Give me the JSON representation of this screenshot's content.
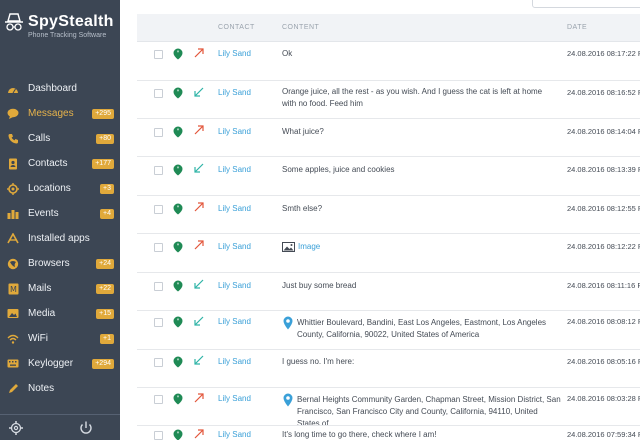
{
  "brand": {
    "title": "SpyStealth",
    "subtitle": "Phone Tracking Software"
  },
  "nav": [
    {
      "label": "Dashboard",
      "badge": "",
      "icon": "dashboard-icon",
      "active": false
    },
    {
      "label": "Messages",
      "badge": "+295",
      "icon": "messages-icon",
      "active": true
    },
    {
      "label": "Calls",
      "badge": "+80",
      "icon": "phone-icon",
      "active": false
    },
    {
      "label": "Contacts",
      "badge": "+177",
      "icon": "contacts-icon",
      "active": false
    },
    {
      "label": "Locations",
      "badge": "+3",
      "icon": "location-icon",
      "active": false
    },
    {
      "label": "Events",
      "badge": "+4",
      "icon": "events-icon",
      "active": false
    },
    {
      "label": "Installed apps",
      "badge": "",
      "icon": "apps-icon",
      "active": false
    },
    {
      "label": "Browsers",
      "badge": "+24",
      "icon": "browser-icon",
      "active": false
    },
    {
      "label": "Mails",
      "badge": "+22",
      "icon": "mail-icon",
      "active": false
    },
    {
      "label": "Media",
      "badge": "+15",
      "icon": "media-icon",
      "active": false
    },
    {
      "label": "WiFi",
      "badge": "+1",
      "icon": "wifi-icon",
      "active": false
    },
    {
      "label": "Keylogger",
      "badge": "+294",
      "icon": "keyboard-icon",
      "active": false
    },
    {
      "label": "Notes",
      "badge": "",
      "icon": "notes-icon",
      "active": false
    }
  ],
  "table": {
    "headers": {
      "contact": "CONTACT",
      "content": "CONTENT",
      "date": "DATE"
    },
    "rows": [
      {
        "direction": "outgoing",
        "contact": "Lily Sand",
        "content": "Ok",
        "kind": "text",
        "date": "24.08.2016 08:17:22 PM"
      },
      {
        "direction": "incoming",
        "contact": "Lily Sand",
        "content": "Orange juice, all the rest - as you wish. And I guess the cat is left at home with no food. Feed him",
        "kind": "text",
        "date": "24.08.2016 08:16:52 PM"
      },
      {
        "direction": "outgoing",
        "contact": "Lily Sand",
        "content": "What juice?",
        "kind": "text",
        "date": "24.08.2016 08:14:04 PM"
      },
      {
        "direction": "incoming",
        "contact": "Lily Sand",
        "content": "Some apples, juice and cookies",
        "kind": "text",
        "date": "24.08.2016 08:13:39 PM"
      },
      {
        "direction": "outgoing",
        "contact": "Lily Sand",
        "content": "Smth else?",
        "kind": "text",
        "date": "24.08.2016 08:12:55 PM"
      },
      {
        "direction": "outgoing",
        "contact": "Lily Sand",
        "content": "Image",
        "kind": "image",
        "date": "24.08.2016 08:12:22 PM"
      },
      {
        "direction": "incoming",
        "contact": "Lily Sand",
        "content": "Just buy some bread",
        "kind": "text",
        "date": "24.08.2016 08:11:16 PM"
      },
      {
        "direction": "incoming",
        "contact": "Lily Sand",
        "content": "Whittier Boulevard, Bandini, East Los Angeles, Eastmont, Los Angeles County, California, 90022, United States of America",
        "kind": "location",
        "date": "24.08.2016 08:08:12 PM"
      },
      {
        "direction": "incoming",
        "contact": "Lily Sand",
        "content": "I guess no. I'm here:",
        "kind": "text",
        "date": "24.08.2016 08:05:16 PM"
      },
      {
        "direction": "outgoing",
        "contact": "Lily Sand",
        "content": "Bernal Heights Community Garden, Chapman Street, Mission District, San Francisco, San Francisco City and County, California, 94110, United States of",
        "kind": "location",
        "date": "24.08.2016 08:03:28 PM"
      },
      {
        "direction": "outgoing",
        "contact": "Lily Sand",
        "content": "It's long time to go there, check where I am!",
        "kind": "text",
        "date": "24.08.2016 07:59:34 PM"
      }
    ]
  },
  "colors": {
    "sidebar": "#3c4654",
    "accent": "#e0a93b",
    "link": "#3aa0d8",
    "outgoing": "#e2563b",
    "incoming": "#2fb4a6",
    "message_icon": "#1f8a55"
  }
}
